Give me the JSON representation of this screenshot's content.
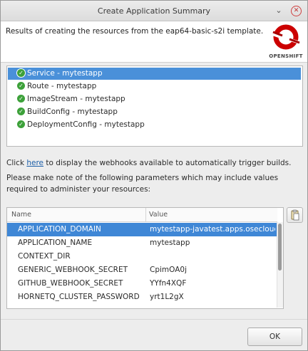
{
  "window": {
    "title": "Create Application Summary",
    "minimize_glyph": "⌄",
    "close_glyph": "✕"
  },
  "header": {
    "text": "Results of creating the resources from the eap64-basic-s2i template.",
    "logo_word": "OPENSHIFT",
    "logo_color": "#cc0000"
  },
  "resources": [
    {
      "label": "Service - mytestapp",
      "status_icon": "check-circle-icon",
      "selected": true
    },
    {
      "label": "Route - mytestapp",
      "status_icon": "check-circle-icon",
      "selected": false
    },
    {
      "label": "ImageStream - mytestapp",
      "status_icon": "check-circle-icon",
      "selected": false
    },
    {
      "label": "BuildConfig - mytestapp",
      "status_icon": "check-circle-icon",
      "selected": false
    },
    {
      "label": "DeploymentConfig - mytestapp",
      "status_icon": "check-circle-icon",
      "selected": false
    }
  ],
  "webhook_note": {
    "prefix": "Click ",
    "link": "here",
    "suffix": " to display the webhooks available to automatically trigger builds."
  },
  "params_note": "Please make note of the following parameters which may include values required to administer your resources:",
  "params_table": {
    "headers": {
      "name": "Name",
      "value": "Value"
    },
    "rows": [
      {
        "name": "APPLICATION_DOMAIN",
        "value": "mytestapp-javatest.apps.osecloud.com"
      },
      {
        "name": "APPLICATION_NAME",
        "value": "mytestapp"
      },
      {
        "name": "CONTEXT_DIR",
        "value": ""
      },
      {
        "name": "GENERIC_WEBHOOK_SECRET",
        "value": "CpimOA0j"
      },
      {
        "name": "GITHUB_WEBHOOK_SECRET",
        "value": "YYfn4XQF"
      },
      {
        "name": "HORNETQ_CLUSTER_PASSWORD",
        "value": "yrt1L2gX"
      }
    ],
    "selected_row": 0
  },
  "buttons": {
    "ok": "OK",
    "copy_icon": "copy-clipboard-icon"
  },
  "colors": {
    "selection": "#4a90d9",
    "link": "#1d5fa8",
    "check": "#3da13a"
  }
}
